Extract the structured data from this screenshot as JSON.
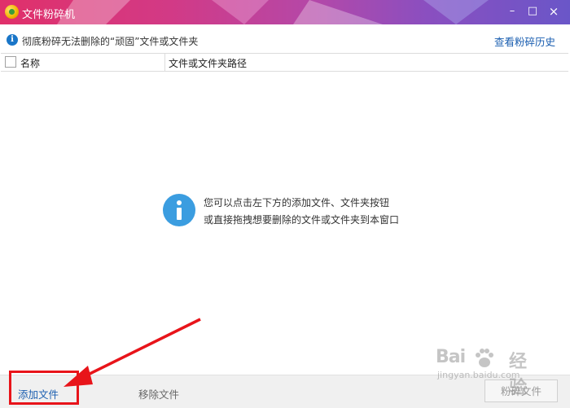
{
  "window": {
    "title": "文件粉碎机",
    "minimize_glyph": "–",
    "maximize_glyph": "□",
    "close_glyph": "×"
  },
  "info_bar": {
    "icon": "info-icon",
    "text": "彻底粉碎无法删除的“顽固”文件或文件夹",
    "history_link": "查看粉碎历史"
  },
  "table": {
    "columns": [
      "名称",
      "文件或文件夹路径"
    ],
    "rows": []
  },
  "empty_state": {
    "icon": "info-icon",
    "line1": "您可以点击左下方的添加文件、文件夹按钮",
    "line2": "或直接拖拽想要删除的文件或文件夹到本窗口"
  },
  "bottom_bar": {
    "add_label": "添加文件",
    "remove_label": "移除文件",
    "shred_label": "粉碎文件"
  },
  "annotation": {
    "highlight_color": "#e8141a"
  },
  "watermark": {
    "brand_left": "Bai",
    "brand_right": "经验",
    "domain": "jingyan.baidu.com"
  },
  "colors": {
    "title_gradient_start": "#e0306a",
    "title_gradient_end": "#6a56c8",
    "link": "#1a5eb0",
    "info_icon": "#3b9de0"
  }
}
